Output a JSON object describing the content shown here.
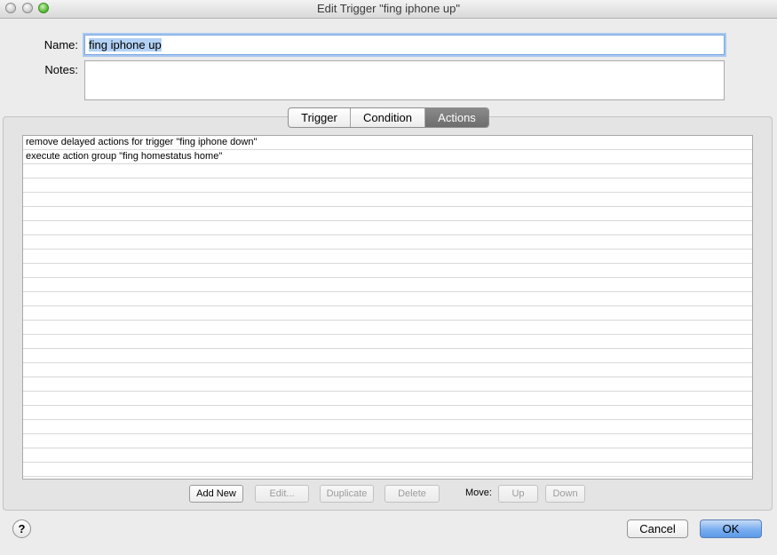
{
  "window": {
    "title": "Edit Trigger \"fing iphone up\""
  },
  "form": {
    "name_label": "Name:",
    "name_value": "fing iphone up",
    "notes_label": "Notes:",
    "notes_value": ""
  },
  "tabs": [
    {
      "label": "Trigger",
      "active": false
    },
    {
      "label": "Condition",
      "active": false
    },
    {
      "label": "Actions",
      "active": true
    }
  ],
  "actions_list": {
    "rows": [
      "remove delayed actions for trigger \"fing iphone down\"",
      "execute action group \"fing homestatus home\""
    ]
  },
  "list_buttons": {
    "add_new": "Add New",
    "edit": "Edit...",
    "duplicate": "Duplicate",
    "delete": "Delete",
    "move_label": "Move:",
    "up": "Up",
    "down": "Down"
  },
  "footer": {
    "help": "?",
    "cancel": "Cancel",
    "ok": "OK"
  },
  "colors": {
    "accent": "#79aef0",
    "active_tab": "#7a7a7a",
    "selection": "#b3d1f5"
  }
}
